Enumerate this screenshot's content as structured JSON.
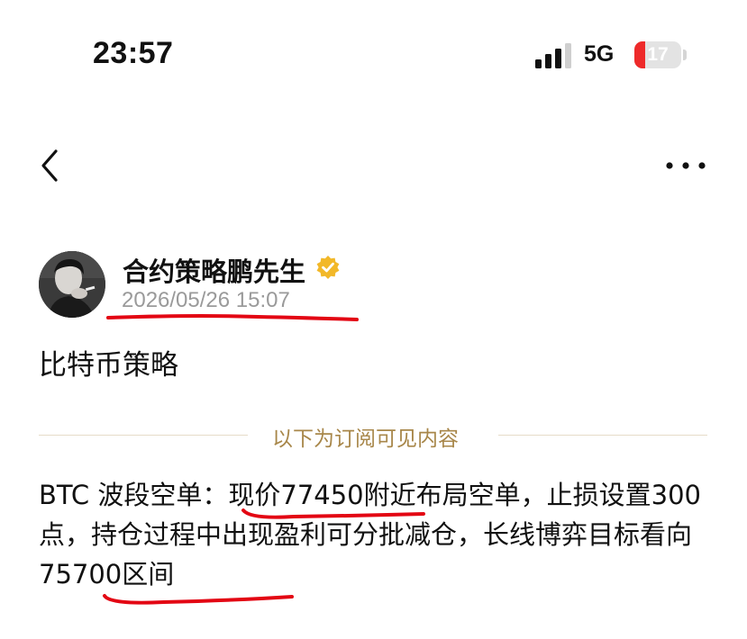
{
  "status_bar": {
    "time": "23:57",
    "network": "5G",
    "battery": "17",
    "signal_icon": "signal-bars-icon",
    "battery_color": "#ee2a2a"
  },
  "nav": {
    "back_icon": "chevron-left-icon",
    "more_icon": "more-horizontal-icon"
  },
  "author": {
    "name": "合约策略鹏先生",
    "verified_icon": "verified-badge-icon",
    "verified_color": "#f2b829",
    "date": "2026/05/26 15:07"
  },
  "post": {
    "title": "比特币策略",
    "subscriber_divider": "以下为订阅可见内容",
    "divider_text_color": "#a8874a",
    "content": "BTC 波段空单：现价77450附近布局空单，止损设置300点，持仓过程中出现盈利可分批减仓，长线博弈目标看向75700区间"
  },
  "annotations": {
    "underline_color": "#e30613"
  }
}
